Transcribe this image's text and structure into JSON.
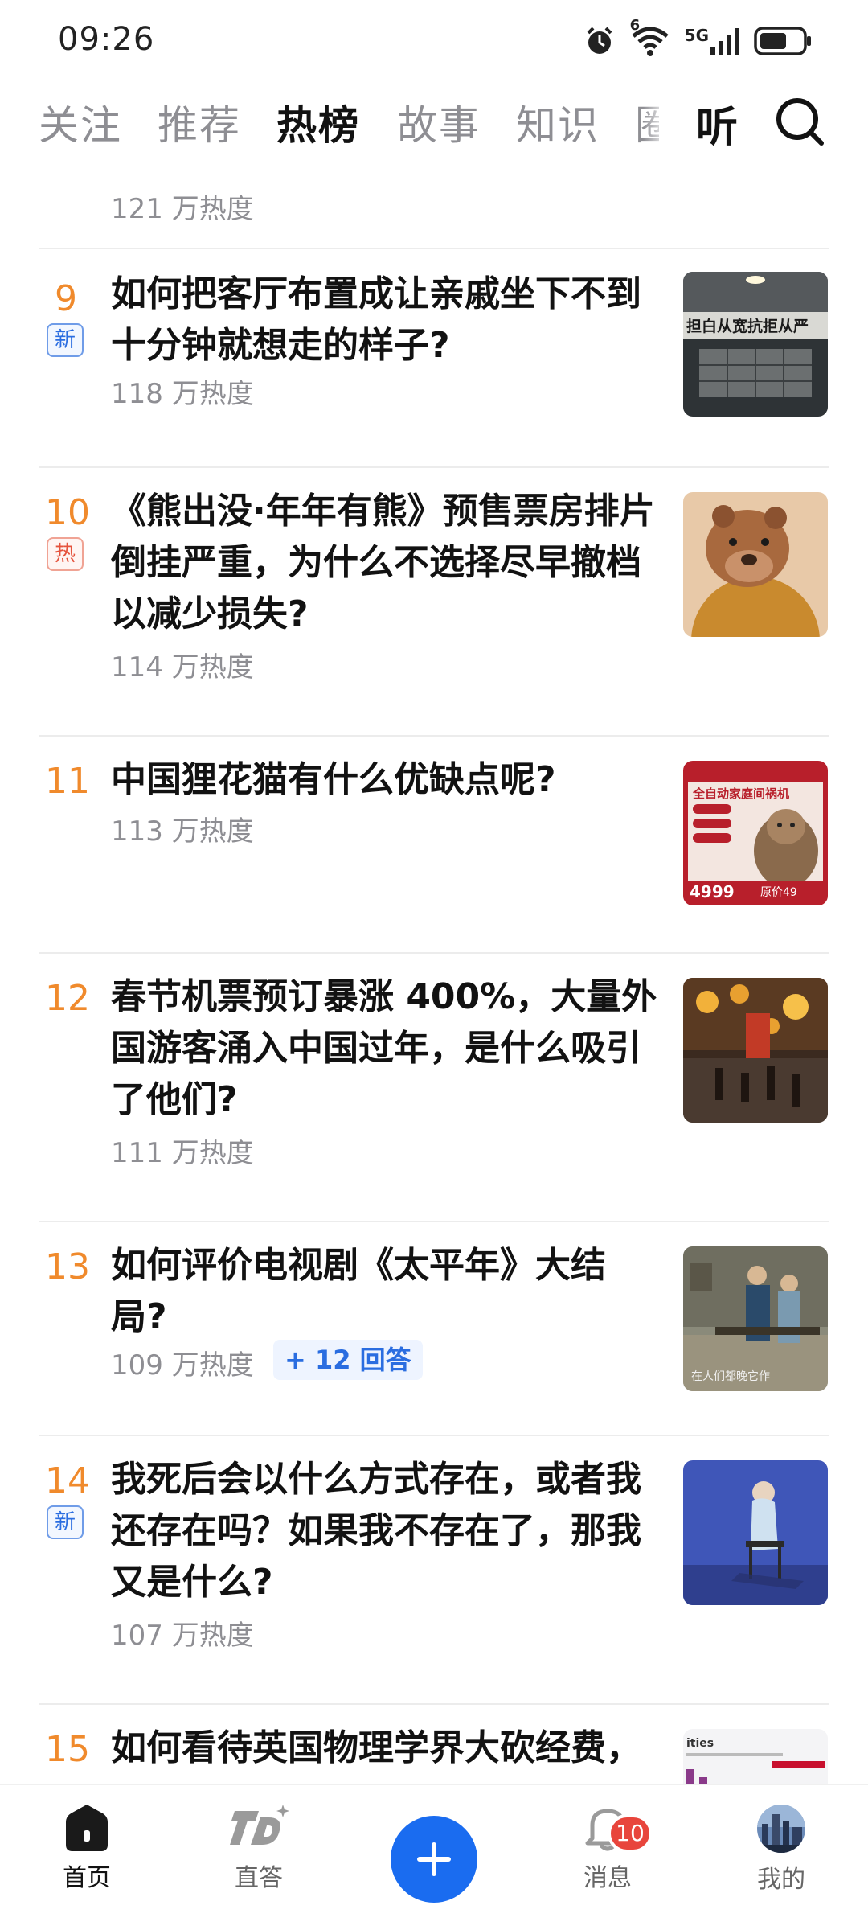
{
  "status_bar": {
    "time": "09:26",
    "network": "5G",
    "signal_superscript": "6"
  },
  "tabs": [
    {
      "label": "关注"
    },
    {
      "label": "推荐"
    },
    {
      "label": "热榜"
    },
    {
      "label": "故事"
    },
    {
      "label": "知识"
    },
    {
      "label": "圈"
    }
  ],
  "listen_label": "听",
  "top_heat": "121 万热度",
  "items": [
    {
      "rank": "9",
      "badge": "新",
      "title": "如何把客厅布置成让亲戚坐下不到十分钟就想走的样子?",
      "heat": "118 万热度",
      "thumb_text": "担白从宽抗拒从严"
    },
    {
      "rank": "10",
      "badge": "热",
      "title": "《熊出没·年年有熊》预售票房排片倒挂严重，为什么不选择尽早撤档以减少损失?",
      "heat": "114 万热度"
    },
    {
      "rank": "11",
      "title": "中国狸花猫有什么优缺点呢?",
      "heat": "113 万热度",
      "thumb_text": "全自动家庭间祸机",
      "thumb_price": "4999",
      "thumb_orig": "原价49"
    },
    {
      "rank": "12",
      "title": "春节机票预订暴涨 400%，大量外国游客涌入中国过年，是什么吸引了他们?",
      "heat": "111 万热度"
    },
    {
      "rank": "13",
      "title": "如何评价电视剧《太平年》大结局?",
      "heat": "109 万热度",
      "answers": "+ 12 回答",
      "thumb_text": "在人们都晚它作"
    },
    {
      "rank": "14",
      "badge": "新",
      "title": "我死后会以什么方式存在，或者我还存在吗？如果我不存在了，那我又是什么?",
      "heat": "107 万热度"
    },
    {
      "rank": "15",
      "title": "如何看待英国物理学界大砍经费，",
      "thumb_text": "ities"
    }
  ],
  "bottom_nav": {
    "home": "首页",
    "zhida": "直答",
    "messages": "消息",
    "messages_count": "10",
    "me": "我的"
  },
  "colors": {
    "rank": "#f08a2c",
    "accent": "#1a6cf0",
    "badge_new": "#2a6de0",
    "badge_hot": "#e5533d"
  }
}
